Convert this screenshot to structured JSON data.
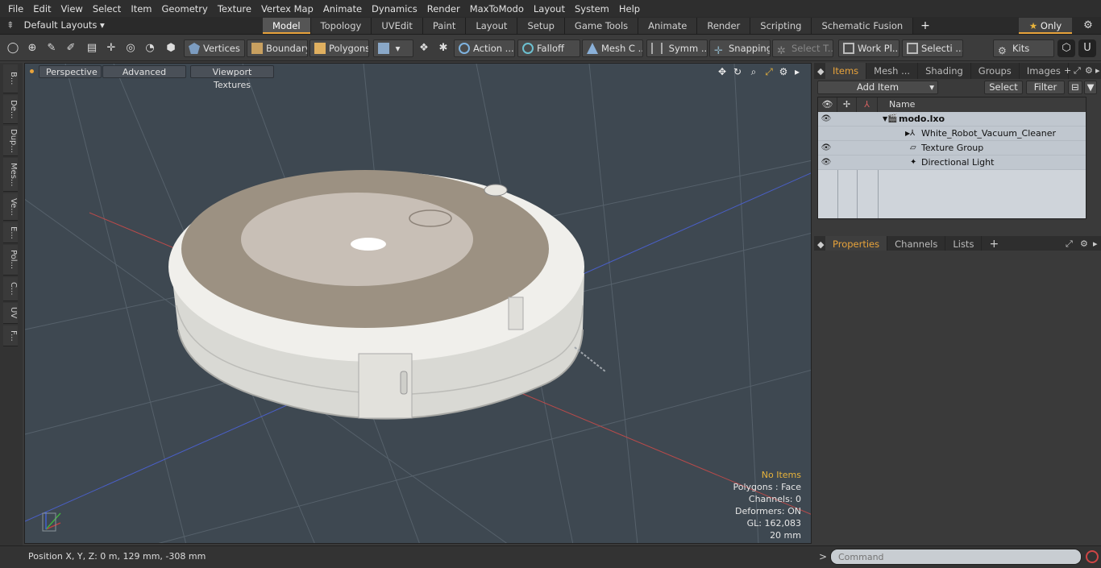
{
  "menu": [
    "File",
    "Edit",
    "View",
    "Select",
    "Item",
    "Geometry",
    "Texture",
    "Vertex Map",
    "Animate",
    "Dynamics",
    "Render",
    "MaxToModo",
    "Layout",
    "System",
    "Help"
  ],
  "layout_selector": "Default Layouts",
  "tabs": [
    "Model",
    "Topology",
    "UVEdit",
    "Paint",
    "Layout",
    "Setup",
    "Game Tools",
    "Animate",
    "Render",
    "Scripting",
    "Schematic Fusion"
  ],
  "active_tab": "Model",
  "only_label": "Only",
  "toolbar": {
    "vertices": "Vertices",
    "boundary": "Boundary",
    "polygons": "Polygons",
    "action": "Action ...",
    "falloff": "Falloff",
    "mesh": "Mesh C ...",
    "symm": "Symm ...",
    "snapping": "Snapping",
    "select_t": "Select T...",
    "work_pl": "Work Pl...",
    "selecti": "Selecti ...",
    "kits": "Kits"
  },
  "left_tabs": [
    "B...",
    "De...",
    "Dup...",
    "Mes...",
    "Ve...",
    "E...",
    "Pol...",
    "C...",
    "UV",
    "F..."
  ],
  "viewport": {
    "perspective": "Perspective",
    "advanced": "Advanced",
    "textures": "Viewport Textures"
  },
  "info": {
    "no_items": "No Items",
    "polygons": "Polygons : Face",
    "channels": "Channels: 0",
    "deformers": "Deformers: ON",
    "gl": "GL: 162,083",
    "scale": "20 mm"
  },
  "status": {
    "position": "Position X, Y, Z:   0 m, 129 mm, -308 mm"
  },
  "items_panel": {
    "tabs": [
      "Items",
      "Mesh ...",
      "Shading",
      "Groups",
      "Images"
    ],
    "add_item": "Add Item",
    "select": "Select",
    "filter": "Filter",
    "name_col": "Name",
    "rows": [
      {
        "label": "modo.lxo",
        "eye": true
      },
      {
        "label": "White_Robot_Vacuum_Cleaner",
        "eye": false
      },
      {
        "label": "Texture Group",
        "eye": true
      },
      {
        "label": "Directional Light",
        "eye": true
      }
    ]
  },
  "props_panel": {
    "tabs": [
      "Properties",
      "Channels",
      "Lists"
    ]
  },
  "command": {
    "placeholder": "Command"
  },
  "colors": {
    "accent": "#e8a33b",
    "viewport_bg": "#3e4851"
  }
}
